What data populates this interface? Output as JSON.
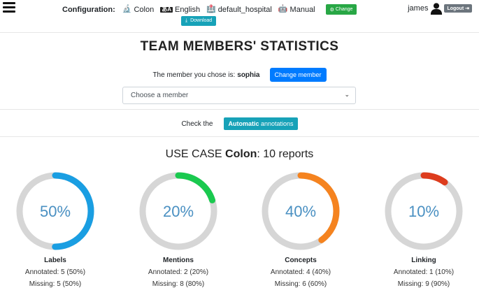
{
  "header": {
    "config_label": "Configuration:",
    "usecase": "Colon",
    "language": "English",
    "institute": "default_hospital",
    "mode": "Manual",
    "change_label": "Change",
    "download_label": "Download",
    "user": "james",
    "logout_label": "Logout"
  },
  "page": {
    "title": "TEAM MEMBERS' STATISTICS",
    "member_prefix": "The member you chose is:",
    "member_name": "sophia",
    "change_member_label": "Change member",
    "select_placeholder": "Choose a member",
    "check_prefix": "Check the",
    "auto_bold": "Automatic",
    "auto_rest": "annotations",
    "usecase_prefix": "USE CASE",
    "usecase_name": "Colon",
    "usecase_suffix": ": 10 reports"
  },
  "stats": [
    {
      "label": "Labels",
      "percent_text": "50%",
      "percent": 50,
      "color": "#1a9ee2",
      "annotated": "Annotated: 5 (50%)",
      "missing": "Missing: 5 (50%)"
    },
    {
      "label": "Mentions",
      "percent_text": "20%",
      "percent": 20,
      "color": "#1ac94f",
      "annotated": "Annotated: 2 (20%)",
      "missing": "Missing: 8 (80%)"
    },
    {
      "label": "Concepts",
      "percent_text": "40%",
      "percent": 40,
      "color": "#f5831f",
      "annotated": "Annotated: 4 (40%)",
      "missing": "Missing: 6 (60%)"
    },
    {
      "label": "Linking",
      "percent_text": "10%",
      "percent": 10,
      "color": "#dd3c1d",
      "annotated": "Annotated: 1 (10%)",
      "missing": "Missing: 9 (90%)"
    }
  ]
}
